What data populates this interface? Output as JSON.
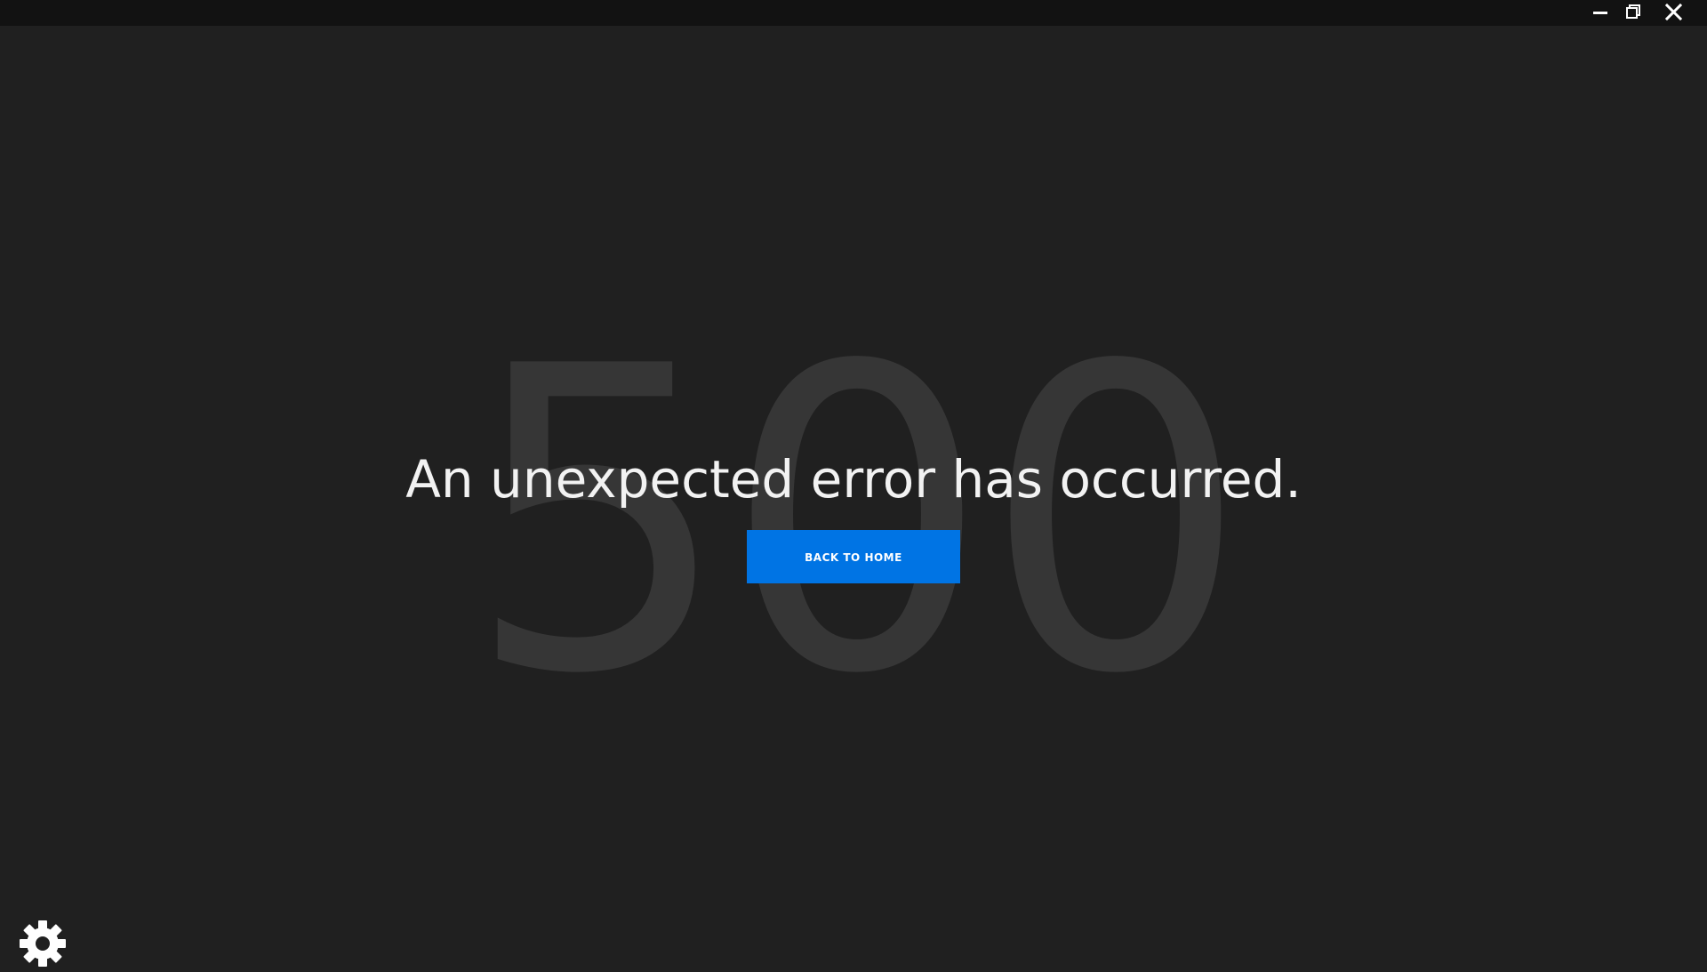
{
  "window_controls": {
    "minimize_icon": "minimize-icon",
    "maximize_icon": "restore-icon",
    "close_icon": "close-icon"
  },
  "error": {
    "code": "500",
    "message": "An unexpected error has occurred.",
    "button_label": "BACK TO HOME"
  },
  "footer": {
    "settings_icon": "gear-icon"
  },
  "colors": {
    "background": "#202020",
    "titlebar": "#121212",
    "accent": "#0074e4",
    "code_text": "#363636",
    "message_text": "#f2f2f2"
  }
}
